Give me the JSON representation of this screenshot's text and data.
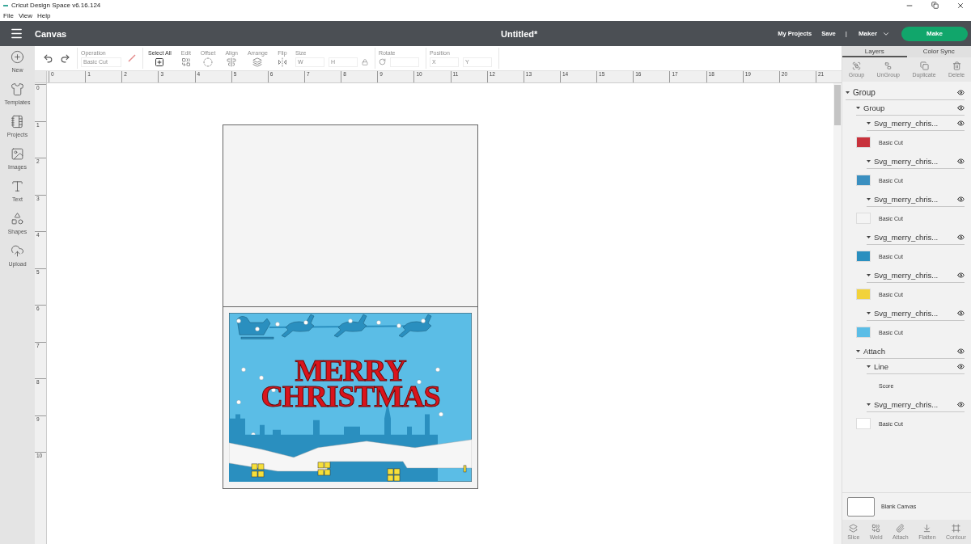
{
  "window": {
    "title": "Cricut Design Space  v6.16.124"
  },
  "menu": [
    "File",
    "View",
    "Help"
  ],
  "header": {
    "title": "Canvas",
    "document": "Untitled*",
    "links": [
      "My Projects",
      "Save"
    ],
    "separator": "|",
    "machine": "Maker",
    "make_button": "Make"
  },
  "sidebar": {
    "items": [
      {
        "kind": "new",
        "label": "New"
      },
      {
        "kind": "templates",
        "label": "Templates"
      },
      {
        "kind": "projects",
        "label": "Projects"
      },
      {
        "kind": "images",
        "label": "Images"
      },
      {
        "kind": "text",
        "label": "Text"
      },
      {
        "kind": "shapes",
        "label": "Shapes"
      },
      {
        "kind": "upload",
        "label": "Upload"
      }
    ]
  },
  "toolbar": {
    "items": [
      {
        "kind": "history",
        "disabled": false
      },
      {
        "kind": "operation",
        "label": "Operation",
        "value": "Basic Cut",
        "disabled": true
      },
      {
        "kind": "tool",
        "label": "Select All",
        "disabled": false
      },
      {
        "kind": "tool",
        "label": "Edit",
        "disabled": true
      },
      {
        "kind": "tool",
        "label": "Offset",
        "disabled": true
      },
      {
        "kind": "tool",
        "label": "Align",
        "disabled": true
      },
      {
        "kind": "tool",
        "label": "Arrange",
        "disabled": true
      },
      {
        "kind": "tool",
        "label": "Flip",
        "disabled": true
      },
      {
        "kind": "size",
        "label": "Size",
        "fields": [
          "W",
          "H"
        ],
        "disabled": true
      },
      {
        "kind": "rotate",
        "label": "Rotate",
        "disabled": true
      },
      {
        "kind": "position",
        "label": "Position",
        "fields": [
          "X",
          "Y"
        ],
        "disabled": true
      }
    ]
  },
  "ruler": {
    "horizontal": [
      "0",
      "1",
      "2",
      "3",
      "4",
      "5",
      "6",
      "7",
      "8",
      "9",
      "10",
      "11",
      "12",
      "13",
      "14",
      "15",
      "16",
      "17",
      "18",
      "19",
      "20",
      "21"
    ],
    "vertical": [
      "0",
      "1",
      "2",
      "3",
      "4",
      "5",
      "6",
      "7",
      "8",
      "9",
      "10"
    ]
  },
  "canvas": {
    "card": {
      "artwork_text": [
        "MERRY",
        "CHRISTMAS"
      ]
    }
  },
  "panel": {
    "tabs": [
      {
        "label": "Layers",
        "selected": true
      },
      {
        "label": "Color Sync",
        "selected": false
      }
    ],
    "actions": [
      {
        "label": "Group",
        "disabled": true
      },
      {
        "label": "UnGroup",
        "disabled": true
      },
      {
        "label": "Duplicate",
        "disabled": true
      },
      {
        "label": "Delete",
        "disabled": true
      }
    ],
    "layers": [
      {
        "label": "Group",
        "expanded": true,
        "children": [
          {
            "label": "Group",
            "expanded": true,
            "children": [
              {
                "label": "Svg_merry_chris...",
                "expanded": true,
                "operation": "Basic Cut",
                "color": "#c8323c"
              },
              {
                "label": "Svg_merry_chris...",
                "expanded": true,
                "operation": "Basic Cut",
                "color": "#3a8fc0"
              },
              {
                "label": "Svg_merry_chris...",
                "expanded": true,
                "operation": "Basic Cut",
                "color": "#f4f4f4"
              },
              {
                "label": "Svg_merry_chris...",
                "expanded": true,
                "operation": "Basic Cut",
                "color": "#2a8fbf"
              },
              {
                "label": "Svg_merry_chris...",
                "expanded": true,
                "operation": "Basic Cut",
                "color": "#f2d23a"
              },
              {
                "label": "Svg_merry_chris...",
                "expanded": true,
                "operation": "Basic Cut",
                "color": "#5bbde6"
              }
            ]
          },
          {
            "label": "Attach",
            "expanded": true,
            "children": [
              {
                "label": "Line",
                "expanded": true,
                "operation": "Score"
              },
              {
                "label": "Svg_merry_chris...",
                "expanded": true,
                "operation": "Basic Cut",
                "color": "#ffffff"
              }
            ]
          }
        ]
      }
    ],
    "blank_canvas": "Blank Canvas",
    "bottom_actions": [
      {
        "label": "Slice",
        "disabled": true
      },
      {
        "label": "Weld",
        "disabled": true
      },
      {
        "label": "Attach",
        "disabled": true
      },
      {
        "label": "Flatten",
        "disabled": true
      },
      {
        "label": "Contour",
        "disabled": true
      }
    ]
  }
}
